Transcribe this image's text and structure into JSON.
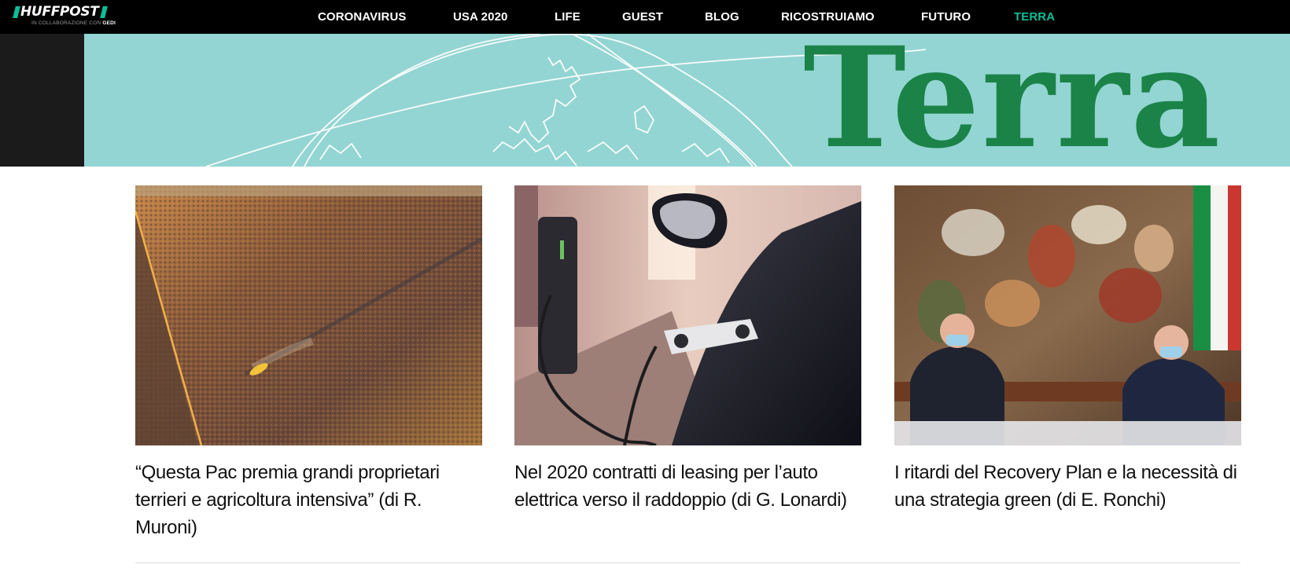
{
  "header": {
    "logo": {
      "text": "HUFFPOST",
      "subtitle_prefix": "IN COLLABORAZIONE CON",
      "subtitle_brand": "GEDI"
    },
    "nav": [
      {
        "label": "CORONAVIRUS",
        "active": false
      },
      {
        "label": "USA 2020",
        "active": false
      },
      {
        "label": "LIFE",
        "active": false
      },
      {
        "label": "GUEST",
        "active": false
      },
      {
        "label": "BLOG",
        "active": false
      },
      {
        "label": "RICOSTRUIAMO",
        "active": false
      },
      {
        "label": "FUTURO",
        "active": false
      },
      {
        "label": "TERRA",
        "active": true
      }
    ]
  },
  "banner": {
    "title": "Terra"
  },
  "articles": [
    {
      "title": "“Questa Pac premia grandi proprietari terrieri e agricoltura intensiva” (di R. Muroni)",
      "image": "aerial-field-harvester"
    },
    {
      "title": "Nel 2020 contratti di leasing per l’auto elettrica verso il raddoppio (di G. Lonardi)",
      "image": "electric-car-charging"
    },
    {
      "title": "I ritardi del Recovery Plan e la necessità di una strategia green (di E. Ronchi)",
      "image": "press-conference-fresco"
    }
  ],
  "colors": {
    "topbar": "#000000",
    "accent": "#0dbe98",
    "banner_bg": "#93d5d3",
    "banner_title": "#1b8348",
    "text": "#111111"
  }
}
